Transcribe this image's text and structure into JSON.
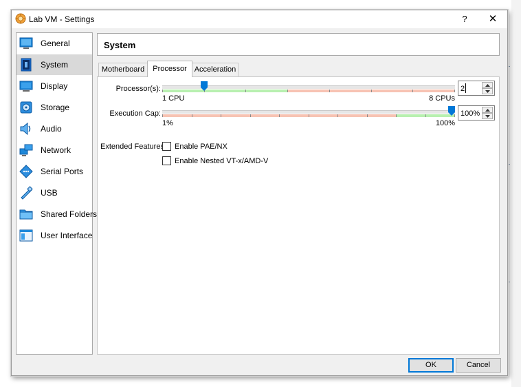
{
  "window": {
    "title": "Lab VM - Settings",
    "help_label": "?",
    "close_label": "✕"
  },
  "sidebar": {
    "items": [
      {
        "label": "General",
        "icon": "general-icon",
        "selected": false
      },
      {
        "label": "System",
        "icon": "system-icon",
        "selected": true
      },
      {
        "label": "Display",
        "icon": "display-icon",
        "selected": false
      },
      {
        "label": "Storage",
        "icon": "storage-icon",
        "selected": false
      },
      {
        "label": "Audio",
        "icon": "audio-icon",
        "selected": false
      },
      {
        "label": "Network",
        "icon": "network-icon",
        "selected": false
      },
      {
        "label": "Serial Ports",
        "icon": "serial-ports-icon",
        "selected": false
      },
      {
        "label": "USB",
        "icon": "usb-icon",
        "selected": false
      },
      {
        "label": "Shared Folders",
        "icon": "shared-folders-icon",
        "selected": false
      },
      {
        "label": "User Interface",
        "icon": "user-interface-icon",
        "selected": false
      }
    ]
  },
  "page": {
    "title": "System"
  },
  "tabs": [
    {
      "label": "Motherboard",
      "active": false
    },
    {
      "label": "Processor",
      "active": true
    },
    {
      "label": "Acceleration",
      "active": false
    }
  ],
  "processor": {
    "processors_label": "Processor(s):",
    "processors_min_label": "1 CPU",
    "processors_max_label": "8 CPUs",
    "processors_min": 1,
    "processors_max": 8,
    "processors_value": "2",
    "processors_recommended_max": 4,
    "exec_cap_label": "Execution Cap:",
    "exec_cap_min_label": "1%",
    "exec_cap_max_label": "100%",
    "exec_cap_min": 1,
    "exec_cap_max": 100,
    "exec_cap_value": "100%",
    "exec_cap_warning_below": 80,
    "extended_label": "Extended Features:",
    "pae_label": "Enable PAE/NX",
    "pae_checked": false,
    "nested_label": "Enable Nested VT-x/AMD-V",
    "nested_checked": false
  },
  "buttons": {
    "ok": "OK",
    "cancel": "Cancel"
  },
  "colors": {
    "accent": "#0078d7",
    "range_ok": "#b8f0b0",
    "range_warn": "#f7c3b3",
    "selected_bg": "#d9d9d9"
  }
}
